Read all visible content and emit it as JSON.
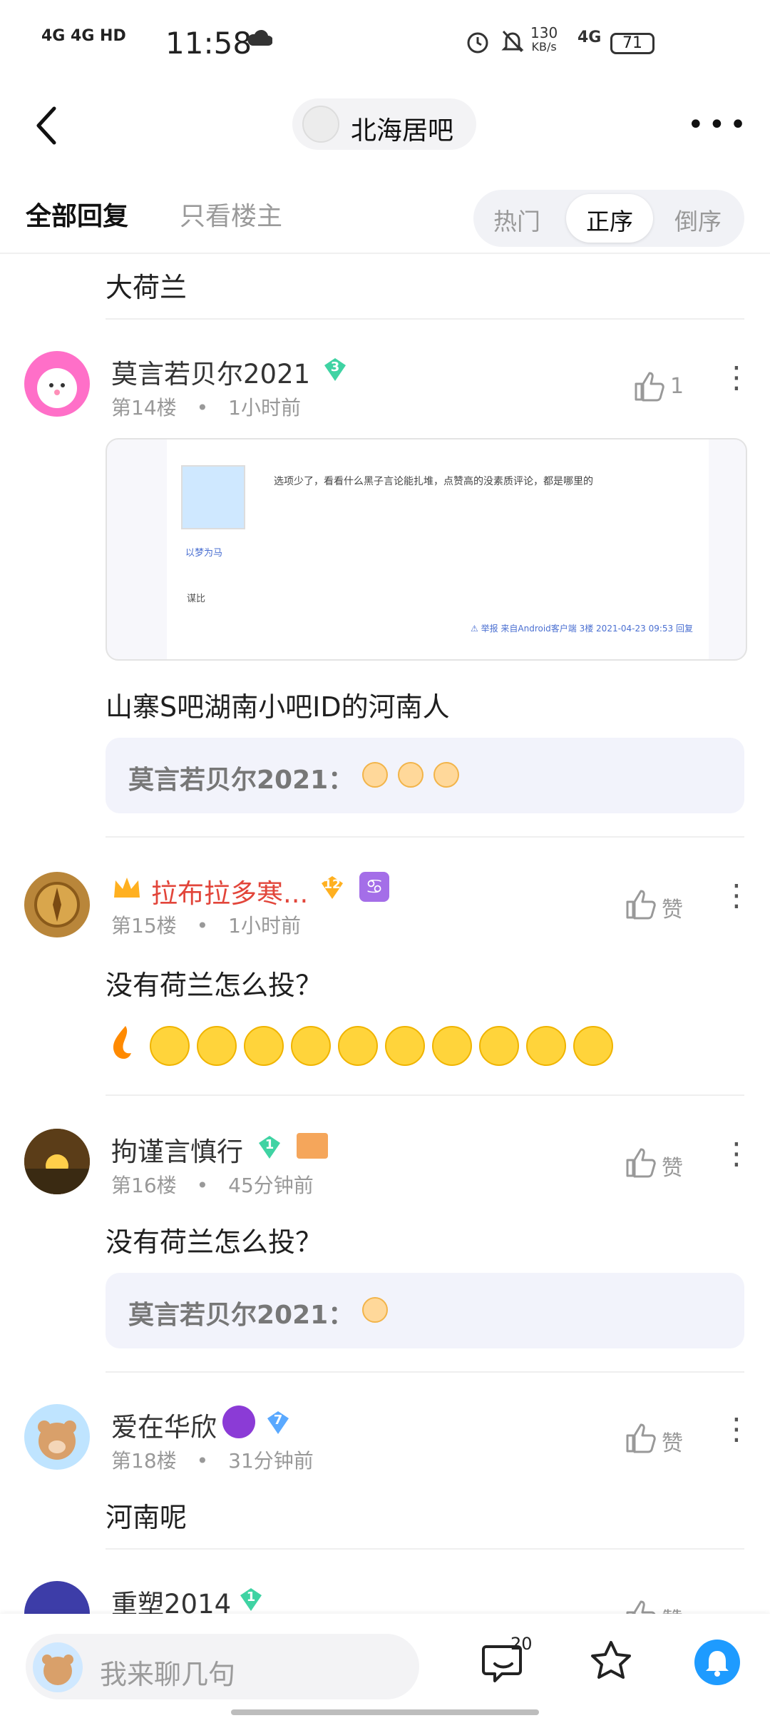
{
  "status_bar": {
    "network": "4G 4G HD",
    "time": "11:58",
    "speed_value": "130",
    "speed_unit": "KB/s",
    "signal2": "4G",
    "battery": "71"
  },
  "header": {
    "forum_name": "北海居吧"
  },
  "tabs": {
    "all_replies": "全部回复",
    "owner_only": "只看楼主",
    "sort_hot": "热门",
    "sort_asc": "正序",
    "sort_desc": "倒序"
  },
  "posts": [
    {
      "text": "大荷兰"
    },
    {
      "username": "莫言若贝尔2021",
      "level": "3",
      "floor": "第14楼",
      "time": "1小时前",
      "likes": "1",
      "screenshot": {
        "text": "选项少了，看看什么黑子言论能扎堆，点赞高的没素质评论，都是哪里的",
        "user": "以梦为马",
        "footer": "⚠ 举报 来自Android客户端 3楼 2021-04-23 09:53 回复",
        "badge": "谋比"
      },
      "text": "山寨S吧湖南小吧ID的河南人",
      "quote": {
        "author": "莫言若贝尔2021："
      }
    },
    {
      "username": "拉布拉多寒...",
      "level": "12",
      "floor": "第15楼",
      "time": "1小时前",
      "like_label": "赞",
      "text": "没有荷兰怎么投？"
    },
    {
      "username": "拘谨言慎行",
      "level": "1",
      "floor": "第16楼",
      "time": "45分钟前",
      "like_label": "赞",
      "text": "没有荷兰怎么投？",
      "quote": {
        "author": "莫言若贝尔2021："
      }
    },
    {
      "username": "爱在华欣",
      "level": "7",
      "floor": "第18楼",
      "time": "31分钟前",
      "like_label": "赞",
      "text": "河南呢"
    },
    {
      "username": "重塑2014",
      "level": "1",
      "like_label": "赞"
    }
  ],
  "bottom_bar": {
    "input_placeholder": "我来聊几句",
    "comment_count": "20"
  },
  "colors": {
    "vip_name": "#e2453a",
    "accent_blue": "#1e9bff",
    "level_green": "#3fd3a3",
    "level_orange": "#ffb020",
    "level_blue": "#5aa9ff"
  }
}
